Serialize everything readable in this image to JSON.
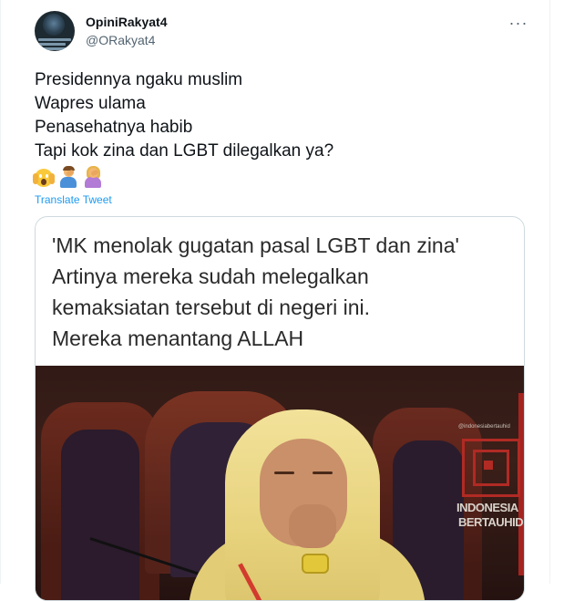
{
  "tweet": {
    "author": {
      "display_name": "OpiniRakyat4",
      "handle": "@ORakyat4",
      "avatar_icon": "profile-avatar"
    },
    "more_icon": "ellipsis-icon",
    "more_label": "···",
    "text_lines": [
      "Presidennya ngaku muslim",
      "Wapres ulama",
      "Penasehatnya habib",
      "Tapi kok zina dan LGBT dilegalkan ya?"
    ],
    "emojis": [
      "face-screaming-in-fear",
      "man-facepalming",
      "woman-facepalming"
    ],
    "translate_label": "Translate Tweet",
    "media": {
      "caption_lines": [
        "'MK menolak gugatan pasal LGBT dan zina'",
        "Artinya mereka sudah melegalkan",
        "kemaksiatan tersebut di negeri ini.",
        "Mereka menantang ALLAH"
      ],
      "watermark_small": "@indonesiabertauhid",
      "watermark_line1": "INDONESIA",
      "watermark_line2": "BERTAUHID"
    }
  },
  "colors": {
    "text_primary": "#0f1419",
    "text_secondary": "#536471",
    "link": "#1d9bf0",
    "border": "#cfd9de"
  }
}
